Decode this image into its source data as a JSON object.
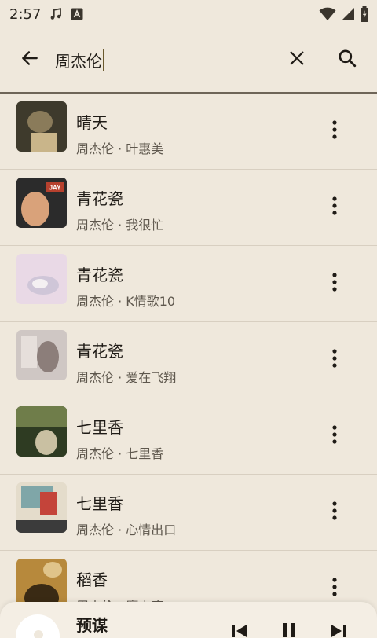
{
  "status_bar": {
    "time": "2:57",
    "icons": [
      "music-note-icon",
      "notification-a-icon",
      "wifi-icon",
      "signal-icon",
      "battery-icon"
    ]
  },
  "search": {
    "query": "周杰伦",
    "icons": {
      "back": "arrow-back-icon",
      "clear": "close-icon",
      "search": "search-icon"
    }
  },
  "results": [
    {
      "title": "晴天",
      "subtitle": "周杰伦 · 叶惠美",
      "cover_colors": [
        "#3e3a2c",
        "#8a7b5a",
        "#c9b58a"
      ]
    },
    {
      "title": "青花瓷",
      "subtitle": "周杰伦 · 我很忙",
      "cover_colors": [
        "#2b2b2b",
        "#b7412e",
        "#d9a27a"
      ],
      "cover_badge": "JAY"
    },
    {
      "title": "青花瓷",
      "subtitle": "周杰伦 · K情歌10",
      "cover_colors": [
        "#e9d9e6",
        "#cfc6d8",
        "#f4f0f2"
      ]
    },
    {
      "title": "青花瓷",
      "subtitle": "周杰伦 · 爱在飞翔",
      "cover_colors": [
        "#cfc7c4",
        "#8c7e7a",
        "#e6dfdb"
      ]
    },
    {
      "title": "七里香",
      "subtitle": "周杰伦 · 七里香",
      "cover_colors": [
        "#2e3b22",
        "#6f7d4a",
        "#c9c0a2"
      ]
    },
    {
      "title": "七里香",
      "subtitle": "周杰伦 · 心情出口",
      "cover_colors": [
        "#7fa6a8",
        "#c4443a",
        "#e4dccb"
      ]
    },
    {
      "title": "稻香",
      "subtitle": "周杰伦 · 魔杰座",
      "cover_colors": [
        "#3a2a14",
        "#b7893c",
        "#e0c48a"
      ]
    }
  ],
  "mini_player": {
    "title": "预谋",
    "icons": {
      "prev": "skip-previous-icon",
      "pause": "pause-icon",
      "next": "skip-next-icon"
    }
  },
  "colors": {
    "background": "#efe8dc",
    "text_primary": "#1f1b16",
    "text_secondary": "#5e574d",
    "divider": "#d8cfc1"
  }
}
